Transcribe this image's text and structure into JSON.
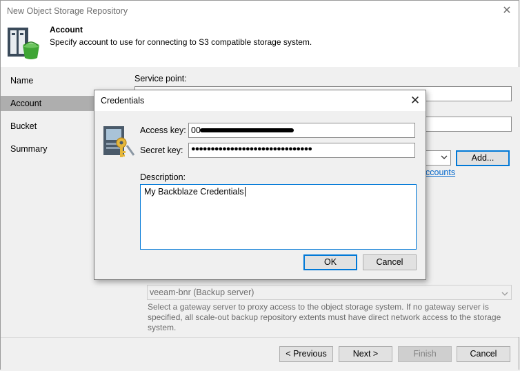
{
  "window": {
    "title": "New Object Storage Repository",
    "close_glyph": "✕"
  },
  "header": {
    "title": "Account",
    "subtitle": "Specify account to use for connecting to S3 compatible storage system.",
    "icon": "storage-bucket-icon"
  },
  "sidebar": {
    "items": [
      {
        "label": "Name",
        "active": false
      },
      {
        "label": "Account",
        "active": true
      },
      {
        "label": "Bucket",
        "active": false
      },
      {
        "label": "Summary",
        "active": false
      }
    ]
  },
  "main": {
    "service_point_label": "Service point:",
    "add_button": "Add...",
    "accounts_link": "ccounts",
    "gateway_value": "veeam-bnr (Backup server)",
    "gateway_hint": "Select a gateway server to proxy access to the object storage system. If no gateway server is specified, all scale-out backup repository extents must have direct network access to the storage system."
  },
  "footer": {
    "previous": "< Previous",
    "next": "Next >",
    "finish": "Finish",
    "cancel": "Cancel"
  },
  "dialog": {
    "title": "Credentials",
    "close_glyph": "✕",
    "icon": "key-server-icon",
    "access_key_label": "Access key:",
    "access_key_value": "00",
    "secret_key_label": "Secret key:",
    "secret_key_value": "●●●●●●●●●●●●●●●●●●●●●●●●●●●●●●●",
    "description_label": "Description:",
    "description_value": "My Backblaze Credentials",
    "ok": "OK",
    "cancel": "Cancel"
  },
  "colors": {
    "accent": "#0078d7",
    "link": "#0066cc",
    "active_nav": "#aeaeae"
  }
}
